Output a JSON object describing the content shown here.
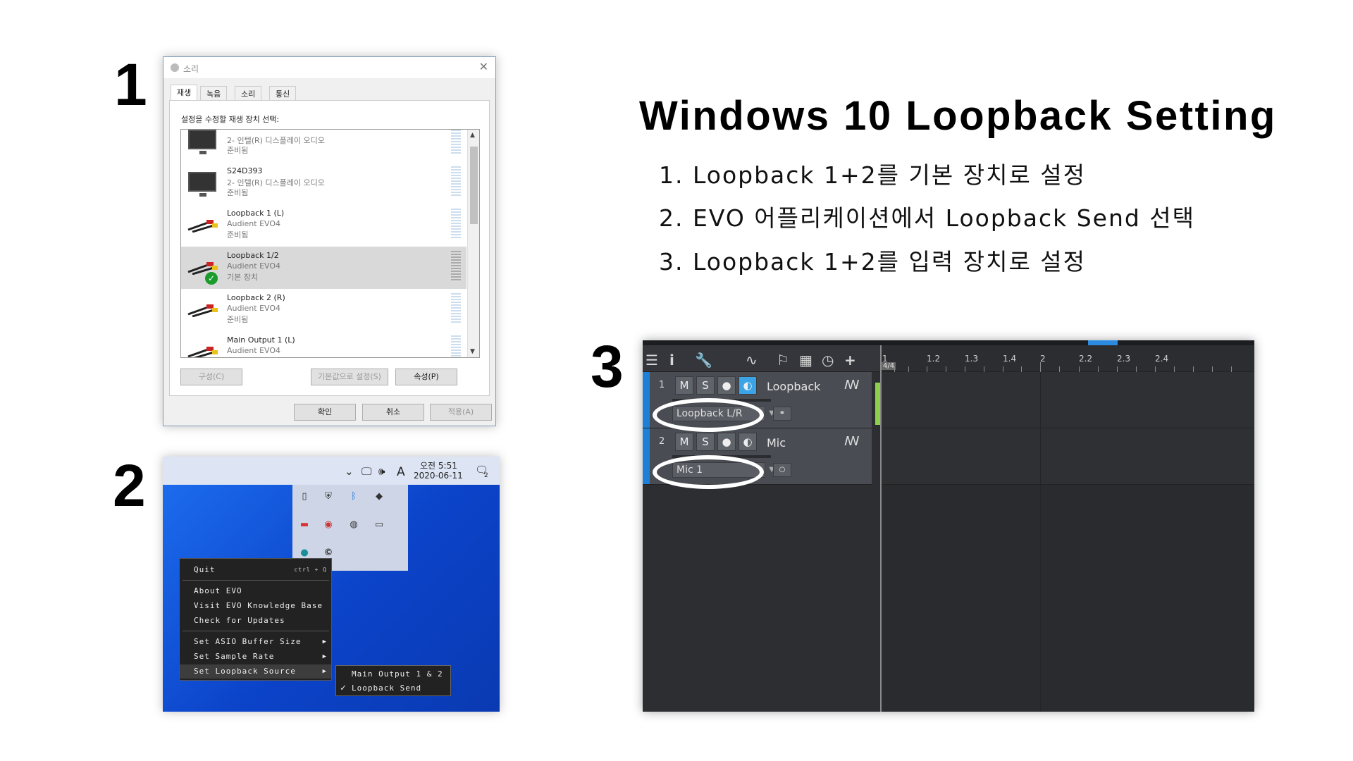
{
  "numbers": {
    "n1": "1",
    "n2": "2",
    "n3": "3"
  },
  "title": "Windows 10 Loopback Setting",
  "steps": [
    "1. Loopback 1+2를 기본 장치로 설정",
    "2. EVO 어플리케이션에서 Loopback Send 선택",
    "3. Loopback 1+2를 입력 장치로 설정"
  ],
  "sound_dialog": {
    "window_title": "소리",
    "tabs": [
      "재생",
      "녹음",
      "소리",
      "통신"
    ],
    "instruction": "설정을 수정할 재생 장치 선택:",
    "devices": [
      {
        "name": "",
        "sub": "2- 인텔(R) 디스플레이 오디오",
        "status": "준비됨",
        "icon": "monitor-icon"
      },
      {
        "name": "S24D393",
        "sub": "2- 인텔(R) 디스플레이 오디오",
        "status": "준비됨",
        "icon": "monitor-icon"
      },
      {
        "name": "Loopback 1 (L)",
        "sub": "Audient EVO4",
        "status": "준비됨",
        "icon": "rca-cable-icon"
      },
      {
        "name": "Loopback 1/2",
        "sub": "Audient EVO4",
        "status": "기본 장치",
        "icon": "rca-cable-icon",
        "selected": true
      },
      {
        "name": "Loopback 2 (R)",
        "sub": "Audient EVO4",
        "status": "준비됨",
        "icon": "rca-cable-icon"
      },
      {
        "name": "Main Output 1 (L)",
        "sub": "Audient EVO4",
        "status": "",
        "icon": "rca-cable-icon"
      }
    ],
    "buttons": {
      "configure": "구성(C)",
      "set_default": "기본값으로 설정(S)",
      "properties": "속성(P)",
      "ok": "확인",
      "cancel": "취소",
      "apply": "적용(A)"
    }
  },
  "taskbar": {
    "ime": "A",
    "time": "오전 5:51",
    "date": "2020-06-11",
    "notification_count": "2",
    "tray_icons": [
      "usb-icon",
      "shield-icon",
      "bluetooth-icon",
      "diamond-icon",
      "flag-icon",
      "gauge-icon",
      "disc-icon",
      "chat-icon",
      "globe-icon",
      "evo-icon"
    ]
  },
  "evo_menu": {
    "quit": "Quit",
    "quit_shortcut": "ctrl + Q",
    "about": "About EVO",
    "kb": "Visit EVO Knowledge Base",
    "updates": "Check for Updates",
    "asio": "Set ASIO Buffer Size",
    "rate": "Set Sample Rate",
    "loopback": "Set Loopback Source",
    "sub_main": "Main Output 1 & 2",
    "sub_send": "Loopback Send",
    "sub_check": "✓"
  },
  "daw": {
    "ruler": [
      "1",
      "1.2",
      "1.3",
      "1.4",
      "2",
      "2.2",
      "2.3",
      "2.4"
    ],
    "time_sig": "4/4",
    "tracks": [
      {
        "num": "1",
        "name": "Loopback",
        "input": "Loopback L/R",
        "m": "M",
        "s": "S"
      },
      {
        "num": "2",
        "name": "Mic",
        "input": "Mic 1",
        "m": "M",
        "s": "S"
      }
    ]
  }
}
